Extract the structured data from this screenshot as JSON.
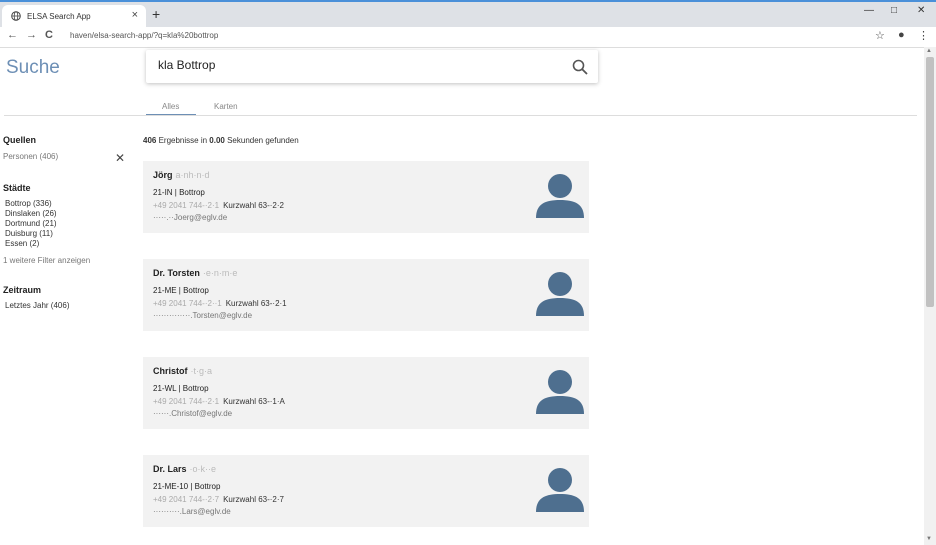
{
  "browser": {
    "tab_title": "ELSA Search App",
    "tab_close": "×",
    "new_tab": "+",
    "url": "haven/elsa-search-app/?q=kla%20bottrop",
    "win_min": "—",
    "win_max": "□",
    "win_close": "✕",
    "back": "←",
    "forward": "→",
    "reload": "C",
    "star": "☆",
    "profile": "●",
    "menu": "⋮"
  },
  "app": {
    "title": "Suche",
    "search_value": "kla Bottrop",
    "tabs": [
      "Alles",
      "Karten"
    ]
  },
  "sidebar": {
    "quellen_heading": "Quellen",
    "quellen_item": "Personen (406)",
    "staedte_heading": "Städte",
    "staedte_items": [
      "Bottrop (336)",
      "Dinslaken (26)",
      "Dortmund (21)",
      "Duisburg (11)",
      "Essen (2)"
    ],
    "more_filters": "1 weitere Filter anzeigen",
    "zeitraum_heading": "Zeitraum",
    "zeitraum_item": "Letztes Jahr (406)"
  },
  "results": {
    "count": "406",
    "count_mid": " Ergebnisse in ",
    "time": "0.00",
    "count_suffix": " Sekunden gefunden",
    "cards": [
      {
        "name": "Jörg",
        "name_blur": "a·nh·n·d",
        "dept": "21-IN | Bottrop",
        "phone": "+49 2041 744-·2·1",
        "kurzwahl": "Kurzwahl 63-·2·2",
        "mail": "·····.··Joerg@eglv.de"
      },
      {
        "name": "Dr. Torsten",
        "name_blur": "·e·n·m·e",
        "dept": "21-ME | Bottrop",
        "phone": "+49 2041 744-·2··1",
        "kurzwahl": "Kurzwahl 63-·2·1",
        "mail": "··············.Torsten@eglv.de"
      },
      {
        "name": "Christof",
        "name_blur": "·t·g·a",
        "dept": "21-WL | Bottrop",
        "phone": "+49 2041 744-·2·1",
        "kurzwahl": "Kurzwahl 63-·1·A",
        "mail": "······.Christof@eglv.de"
      },
      {
        "name": "Dr. Lars",
        "name_blur": "·o·k··e",
        "dept": "21-ME-10 | Bottrop",
        "phone": "+49 2041 744-·2·7",
        "kurzwahl": "Kurzwahl 63-·2·7",
        "mail": "··········.Lars@eglv.de"
      }
    ]
  }
}
